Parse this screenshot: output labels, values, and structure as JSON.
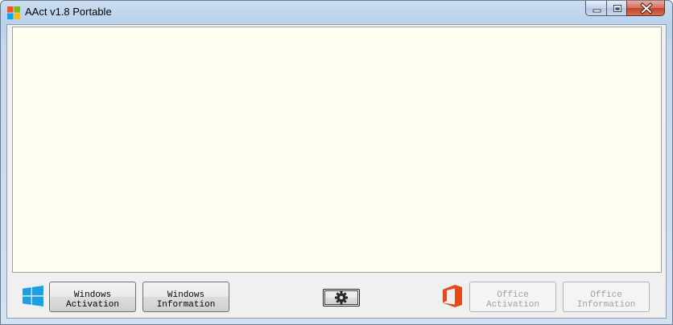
{
  "window": {
    "title": "AAct v1.8 Portable",
    "app_icon": "windows-flag-icon"
  },
  "caption_buttons": {
    "minimize_icon": "minimize-icon",
    "maximize_icon": "maximize-icon",
    "close_icon": "close-icon"
  },
  "log": {
    "text": "",
    "background": "#fffff0"
  },
  "buttons": {
    "windows_activation": {
      "line1": "Windows",
      "line2": "Activation",
      "enabled": true
    },
    "windows_information": {
      "line1": "Windows",
      "line2": "Information",
      "enabled": true
    },
    "settings": {
      "icon": "gear-icon",
      "enabled": true
    },
    "office_activation": {
      "line1": "Office",
      "line2": "Activation",
      "enabled": false
    },
    "office_information": {
      "line1": "Office",
      "line2": "Information",
      "enabled": false
    }
  },
  "colors": {
    "windows_logo": "#1ba1e2",
    "office_logo": "#e64a19",
    "disabled_text": "#a0a0a0"
  }
}
